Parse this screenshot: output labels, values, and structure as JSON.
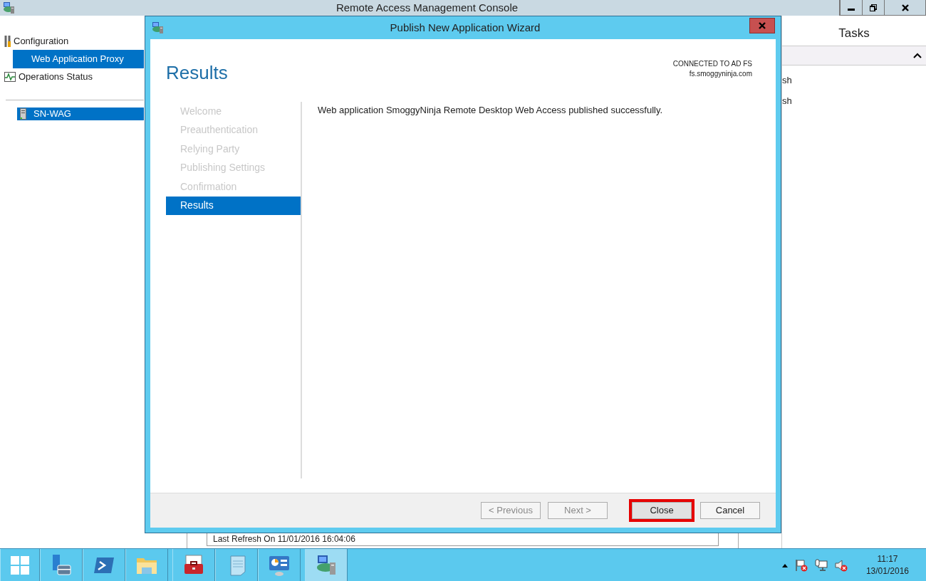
{
  "main_window": {
    "title": "Remote Access Management Console"
  },
  "nav": {
    "items": [
      {
        "label": "Configuration",
        "selected": false,
        "children": [
          {
            "label": "Web Application Proxy",
            "selected": true
          }
        ]
      },
      {
        "label": "Operations Status",
        "selected": false
      }
    ],
    "servers": [
      {
        "label": "SN-WAG",
        "selected": true
      }
    ]
  },
  "tasks": {
    "title": "Tasks",
    "items": [
      "sh",
      "sh"
    ]
  },
  "status": {
    "last_refresh": "Last Refresh On 11/01/2016 16:04:06"
  },
  "dialog": {
    "title": "Publish New Application Wizard",
    "heading": "Results",
    "connection": [
      "CONNECTED TO AD FS",
      "fs.smoggyninja.com"
    ],
    "steps": [
      {
        "label": "Welcome",
        "selected": false
      },
      {
        "label": "Preauthentication",
        "selected": false
      },
      {
        "label": "Relying Party",
        "selected": false
      },
      {
        "label": "Publishing Settings",
        "selected": false
      },
      {
        "label": "Confirmation",
        "selected": false
      },
      {
        "label": "Results",
        "selected": true
      }
    ],
    "message": "Web application SmoggyNinja Remote Desktop Web Access published successfully.",
    "buttons": [
      {
        "label": "< Previous",
        "disabled": true,
        "highlighted": false
      },
      {
        "label": "Next >",
        "disabled": true,
        "highlighted": false
      },
      {
        "label": "Close",
        "disabled": false,
        "highlighted": true
      },
      {
        "label": "Cancel",
        "disabled": false,
        "highlighted": false
      }
    ]
  },
  "taskbar": {
    "apps": [
      {
        "kind": "server-manager",
        "active": false
      },
      {
        "kind": "powershell",
        "active": false
      },
      {
        "kind": "explorer",
        "active": false
      },
      {
        "kind": "toolbox",
        "active": false
      },
      {
        "kind": "notepad",
        "active": false
      },
      {
        "kind": "control-panel",
        "active": false
      },
      {
        "kind": "remote-access",
        "active": true
      }
    ],
    "clock": {
      "time": "11:17",
      "date": "13/01/2016"
    }
  }
}
